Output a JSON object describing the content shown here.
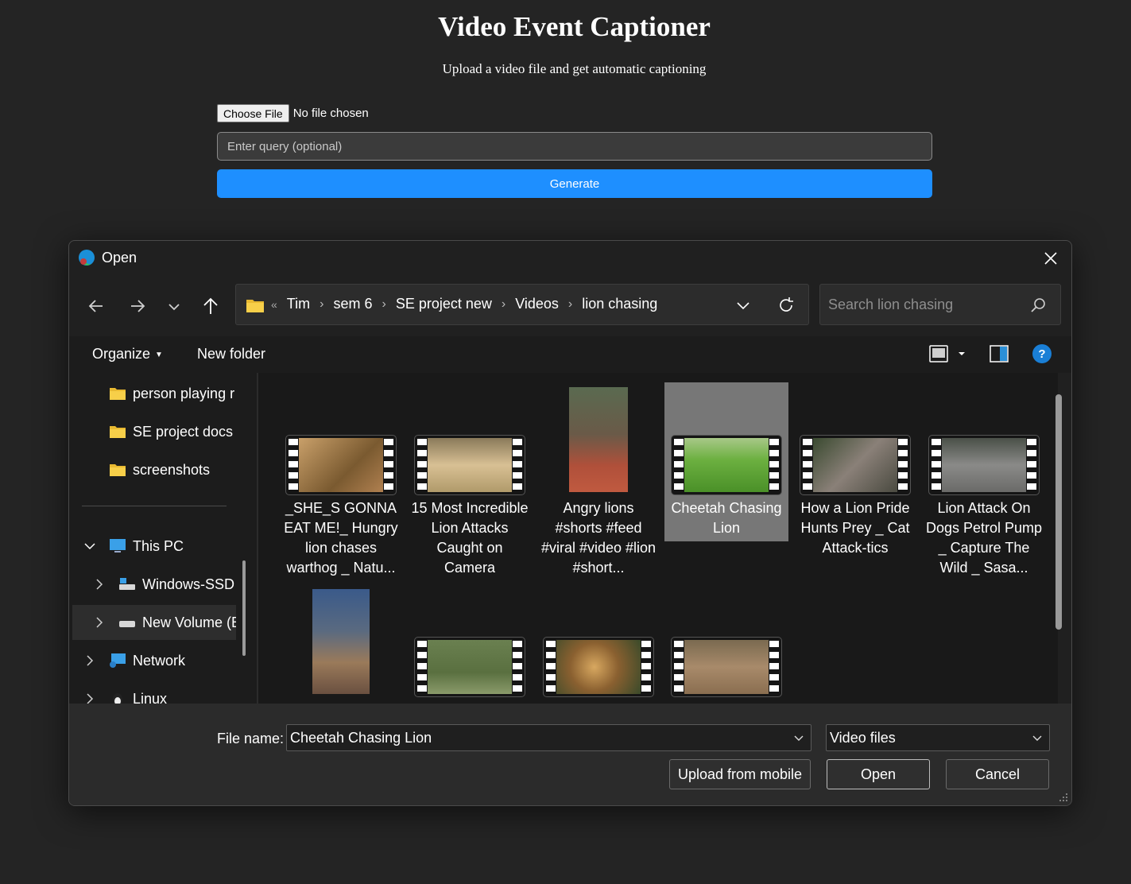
{
  "page": {
    "title": "Video Event Captioner",
    "subtitle": "Upload a video file and get automatic captioning",
    "choose_file_label": "Choose File",
    "no_file_text": "No file chosen",
    "query_placeholder": "Enter query (optional)",
    "generate_label": "Generate"
  },
  "dialog": {
    "title": "Open",
    "breadcrumb": [
      "Tim",
      "sem 6",
      "SE project new",
      "Videos",
      "lion chasing"
    ],
    "breadcrumb_overflow": "«",
    "search_placeholder": "Search lion chasing",
    "organize_label": "Organize",
    "new_folder_label": "New folder",
    "nav_items": [
      {
        "label": "person playing r",
        "icon": "folder-icon"
      },
      {
        "label": "SE project docs",
        "icon": "folder-icon"
      },
      {
        "label": "screenshots",
        "icon": "folder-icon"
      },
      {
        "label": "This PC",
        "icon": "computer-icon"
      },
      {
        "label": "Windows-SSD",
        "icon": "drive-icon"
      },
      {
        "label": "New Volume (E",
        "icon": "drive-icon"
      },
      {
        "label": "Network",
        "icon": "network-icon"
      },
      {
        "label": "Linux",
        "icon": "linux-icon"
      }
    ],
    "files": [
      {
        "label": "_SHE_S GONNA EAT ME!_ Hungry lion chases warthog _ Natu...",
        "thumb": "#9a7a4a"
      },
      {
        "label": "15 Most Incredible Lion Attacks Caught on Camera",
        "thumb": "#b9a27a"
      },
      {
        "label": "Angry lions #shorts #feed #viral #video #lion #short...",
        "thumb": "#7a5a48"
      },
      {
        "label": "Cheetah Chasing Lion",
        "thumb": "#5aa030",
        "selected": true
      },
      {
        "label": "How a Lion Pride Hunts Prey _ Cat Attack-tics",
        "thumb": "#5a5a58"
      },
      {
        "label": "Lion Attack On Dogs Petrol Pump _ Capture The Wild _ Sasa...",
        "thumb": "#6e6e6e"
      },
      {
        "label": "",
        "thumb": "#6a5a4a"
      },
      {
        "label": "",
        "thumb": "#5a7040"
      },
      {
        "label": "",
        "thumb": "#8a6a40"
      },
      {
        "label": "",
        "thumb": "#8a6e50"
      }
    ],
    "file_name_label": "File name:",
    "file_name_value": "Cheetah Chasing Lion",
    "file_type_value": "Video files",
    "upload_mobile_label": "Upload from mobile",
    "open_label": "Open",
    "cancel_label": "Cancel"
  }
}
